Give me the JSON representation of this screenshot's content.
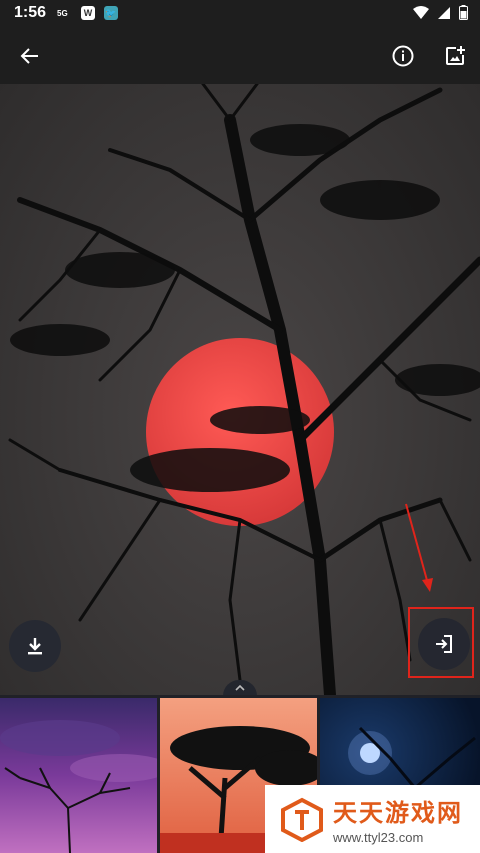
{
  "status_bar": {
    "time": "1:56",
    "network": "5G",
    "app_badge_w": "W",
    "app_badge_bird": "🐦"
  },
  "toolbar": {
    "back_icon": "arrow-back-icon",
    "info_icon": "info-icon",
    "add_icon": "add-photo-icon"
  },
  "viewer": {
    "download_icon": "download-icon",
    "apply_icon": "login-arrow-icon",
    "handle_icon": "chevron-up-icon"
  },
  "watermark": {
    "title": "天天游戏网",
    "url": "www.ttyl23.com"
  },
  "colors": {
    "sun": "#e63a3a",
    "highlight": "#e0241b",
    "bar": "#1e1e1e"
  }
}
